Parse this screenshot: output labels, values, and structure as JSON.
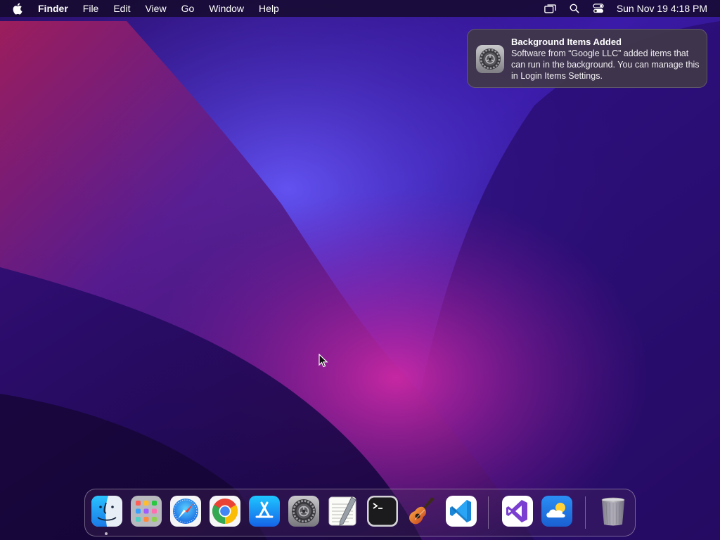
{
  "menubar": {
    "apple_icon": "apple-logo-icon",
    "app_name": "Finder",
    "menus": [
      "File",
      "Edit",
      "View",
      "Go",
      "Window",
      "Help"
    ],
    "status_icons": [
      "screen-mirroring-icon",
      "spotlight-search-icon",
      "control-center-icon"
    ],
    "clock": "Sun Nov 19  4:18 PM"
  },
  "notification": {
    "icon": "system-settings-gear-icon",
    "title": "Background Items Added",
    "body": "Software from “Google LLC” added items that can run in the background. You can manage this in Login Items Settings."
  },
  "dock": {
    "items": [
      {
        "name": "finder",
        "icon": "finder-icon",
        "running": true
      },
      {
        "name": "launchpad",
        "icon": "launchpad-icon",
        "running": false
      },
      {
        "name": "safari",
        "icon": "safari-compass-icon",
        "running": false
      },
      {
        "name": "chrome",
        "icon": "chrome-icon",
        "running": false
      },
      {
        "name": "app-store",
        "icon": "app-store-icon",
        "running": false
      },
      {
        "name": "system-settings",
        "icon": "system-settings-gear-icon",
        "running": false
      },
      {
        "name": "textedit",
        "icon": "textedit-icon",
        "running": false
      },
      {
        "name": "terminal",
        "icon": "terminal-icon",
        "running": false
      },
      {
        "name": "garageband",
        "icon": "garageband-guitar-icon",
        "running": false
      },
      {
        "name": "vscode",
        "icon": "vscode-icon",
        "running": false
      },
      {
        "name": "visual-studio",
        "icon": "visual-studio-icon",
        "running": false
      },
      {
        "name": "weather",
        "icon": "weather-cloud-icon",
        "running": false
      },
      {
        "name": "trash",
        "icon": "trash-icon",
        "running": false
      }
    ]
  },
  "colors": {
    "wallpaper_dark": "#1a0b45",
    "wallpaper_mid": "#3a1a9a",
    "wallpaper_magenta": "#b0208a",
    "notification_bg": "#403846"
  }
}
